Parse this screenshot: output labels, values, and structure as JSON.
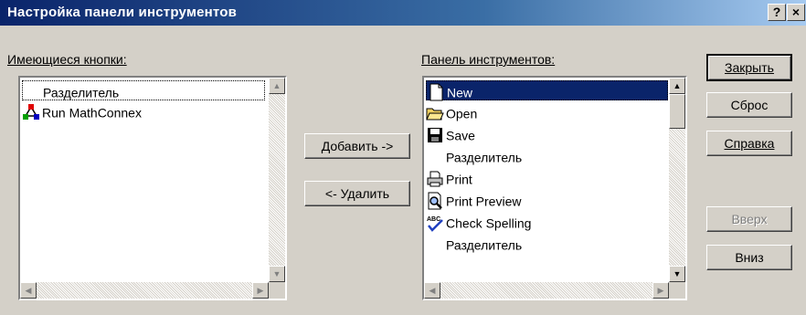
{
  "window": {
    "title": "Настройка панели инструментов",
    "help_button": "?",
    "close_button": "×"
  },
  "available": {
    "label": "Имеющиеся кнопки:",
    "items": [
      {
        "label": "Разделитель",
        "icon": "none"
      },
      {
        "label": "Run MathConnex",
        "icon": "mathconnex-icon"
      }
    ]
  },
  "toolbar": {
    "label": "Панель инструментов:",
    "items": [
      {
        "label": "New",
        "icon": "new-document-icon",
        "selected": true
      },
      {
        "label": "Open",
        "icon": "open-folder-icon"
      },
      {
        "label": "Save",
        "icon": "floppy-disk-icon"
      },
      {
        "label": "Разделитель",
        "icon": "none"
      },
      {
        "label": "Print",
        "icon": "printer-icon"
      },
      {
        "label": "Print Preview",
        "icon": "print-preview-icon"
      },
      {
        "label": "Check Spelling",
        "icon": "spell-check-icon"
      },
      {
        "label": "Разделитель",
        "icon": "none"
      }
    ]
  },
  "buttons": {
    "add": "Добавить ->",
    "remove": "<- Удалить",
    "close": "Закрыть",
    "reset": "Сброс",
    "help": "Справка",
    "up": "Вверх",
    "down": "Вниз"
  },
  "colors": {
    "selection": "#0a246a",
    "face": "#d4d0c8"
  }
}
